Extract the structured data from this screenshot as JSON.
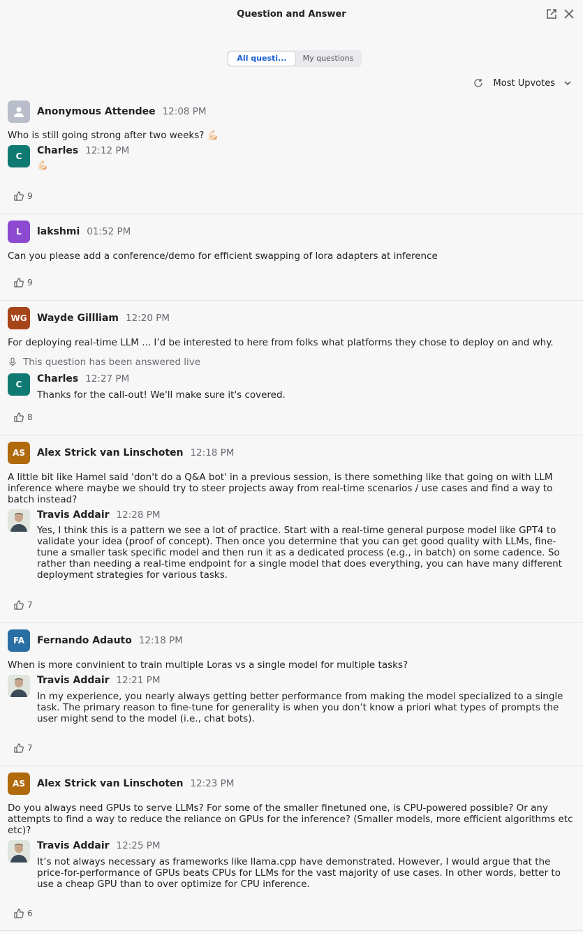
{
  "header": {
    "title": "Question and Answer"
  },
  "tabs": [
    {
      "label": "All questi..."
    },
    {
      "label": "My questions"
    }
  ],
  "sort": {
    "label": "Most Upvotes"
  },
  "answered_live_label": "This question has been answered live",
  "questions": [
    {
      "author": "Anonymous Attendee",
      "initials": "",
      "time": "12:08 PM",
      "text": "Who is still going strong after two weeks? 💪🏻",
      "answer": {
        "author": "Charles",
        "initials": "C",
        "time": "12:12 PM",
        "text": "💪🏻"
      },
      "likes": "9"
    },
    {
      "author": "lakshmi",
      "initials": "L",
      "time": "01:52 PM",
      "text": "Can you please add a conference/demo for efficient swapping of lora adapters at inference",
      "likes": "9"
    },
    {
      "author": "Wayde Gillliam",
      "initials": "WG",
      "time": "12:20 PM",
      "text": "For deploying real-time LLM ... I’d be interested to here from folks what platforms they chose to deploy on and why.",
      "answer": {
        "author": "Charles",
        "initials": "C",
        "time": "12:27 PM",
        "text": "Thanks for the call-out! We'll make sure it's covered."
      },
      "likes": "8"
    },
    {
      "author": "Alex Strick van Linschoten",
      "initials": "AS",
      "time": "12:18 PM",
      "text": "A little bit like Hamel said 'don't do a Q&A bot' in a previous session, is there something like that going on with LLM inference where maybe we should try to steer projects away from real-time scenarios / use cases and find a way to batch instead?",
      "answer": {
        "author": "Travis Addair",
        "time": "12:28 PM",
        "text": "Yes, I think this is a pattern we see a lot of practice. Start with a real-time general purpose model like GPT4 to validate your idea (proof of concept). Then once you determine that you can get good quality with LLMs, fine-tune a smaller task specific model and then run it as a dedicated process (e.g., in batch) on some cadence. So rather than needing a real-time endpoint for a single model that does everything, you can have many different deployment strategies for various tasks."
      },
      "likes": "7"
    },
    {
      "author": "Fernando Adauto",
      "initials": "FA",
      "time": "12:18 PM",
      "text": "When is more convinient to train multiple Loras vs a single model for multiple tasks?",
      "answer": {
        "author": "Travis Addair",
        "time": "12:21 PM",
        "text": "In my experience, you nearly always getting better performance from making the model specialized to a single task. The primary reason to fine-tune for generality is when you don’t know a priori what types of prompts the user might send to the model (i.e., chat bots)."
      },
      "likes": "7"
    },
    {
      "author": "Alex Strick van Linschoten",
      "initials": "AS",
      "time": "12:23 PM",
      "text": "Do you always need GPUs to serve LLMs? For some of the smaller finetuned one, is CPU-powered possible? Or any attempts to find a way to reduce the reliance on GPUs for the inference? (Smaller models, more efficient algorithms etc etc)?",
      "answer": {
        "author": "Travis Addair",
        "time": "12:25 PM",
        "text": "It’s not always necessary as frameworks like llama.cpp have demonstrated. However, I would argue that the price-for-performance of GPUs beats CPUs for LLMs for the vast majority of use cases. In other words, better to use a cheap GPU than to over optimize for CPU inference."
      },
      "likes": "6"
    }
  ],
  "colors": {
    "anonymous": "#b9bdc9",
    "charles": "#0f7a72",
    "lakshmi": "#8c4ad1",
    "wayde": "#a6451a",
    "alex": "#b06a0c",
    "fernando": "#2a6fa3",
    "accent": "#1a5fd1"
  }
}
